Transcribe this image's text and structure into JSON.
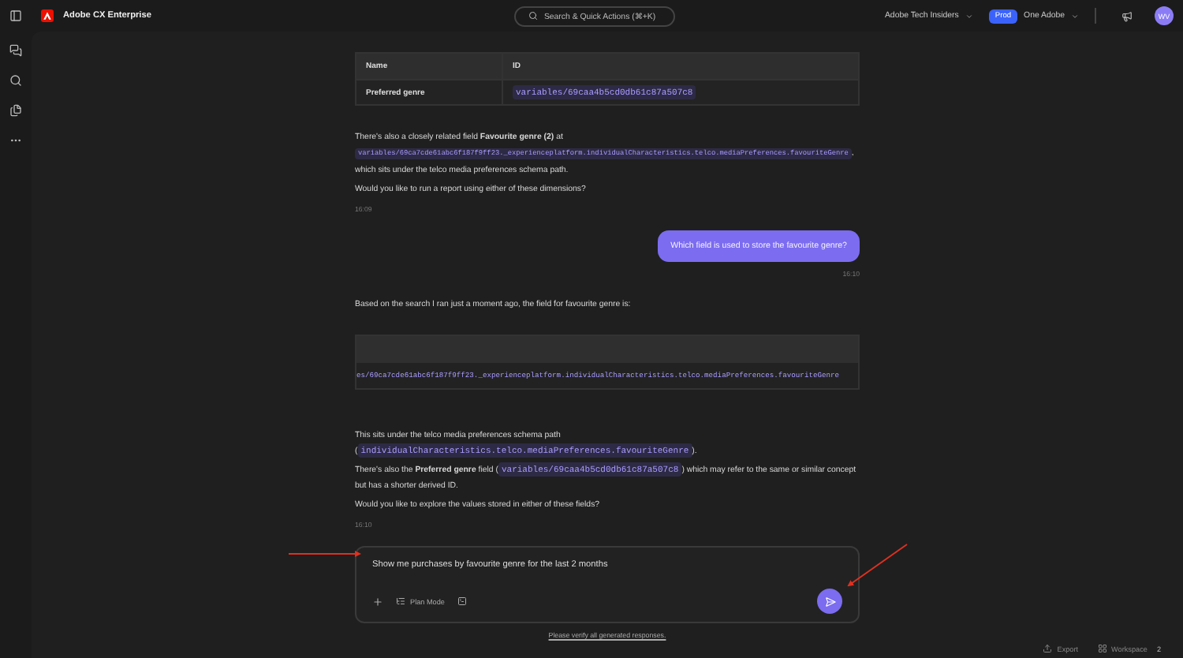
{
  "topbar": {
    "app_name": "Adobe CX Enterprise",
    "search_placeholder": "Search & Quick Actions (⌘+K)",
    "org": "Adobe Tech Insiders",
    "env_badge": "Prod",
    "workspace": "One Adobe",
    "avatar_initials": "WV"
  },
  "messages": [
    {
      "kind": "assistant",
      "blocks": [
        {
          "kind": "table",
          "columns": [
            "Name",
            "ID"
          ],
          "rows": [
            {
              "name": "Preferred genre",
              "id": "variables/69caa4b5cd0db61c87a507c8"
            }
          ]
        },
        {
          "kind": "paragraph",
          "parts": [
            {
              "kind": "text",
              "text": "There's also a closely related field **Favourite genre (2)** at "
            },
            {
              "kind": "code",
              "text": "variables/69ca7cde61abc6f187f9ff23._experienceplatform.individualCharacteristics.telco.mediaPreferences.favouriteGenre"
            },
            {
              "kind": "text",
              "text": ", which sits under the telco media preferences schema path."
            }
          ]
        },
        {
          "kind": "paragraph",
          "parts": [
            {
              "kind": "text",
              "text": "Would you like to run a report using either of these dimensions?"
            }
          ]
        }
      ],
      "time": "16:09"
    },
    {
      "kind": "user",
      "text": "Which field is used to store the favourite genre?",
      "time": "16:10"
    },
    {
      "kind": "assistant",
      "blocks": [
        {
          "kind": "paragraph",
          "parts": [
            {
              "kind": "text",
              "text": "Based on the search I ran just a moment ago, the field for favourite genre is:"
            }
          ]
        },
        {
          "kind": "code_block",
          "code": "es/69ca7cde61abc6f187f9ff23._experienceplatform.individualCharacteristics.telco.mediaPreferences.favouriteGenre"
        },
        {
          "kind": "paragraph",
          "parts": [
            {
              "kind": "text",
              "text": "This sits under the telco media preferences schema path ("
            },
            {
              "kind": "code",
              "text": "individualCharacteristics.telco.mediaPreferences.favouriteGenre"
            },
            {
              "kind": "text",
              "text": ")."
            }
          ]
        },
        {
          "kind": "paragraph",
          "parts": [
            {
              "kind": "text",
              "text": "There's also the **Preferred genre** field ("
            },
            {
              "kind": "code",
              "text": "variables/69caa4b5cd0db61c87a507c8"
            },
            {
              "kind": "text",
              "text": ") which may refer to the same or similar concept but has a shorter derived ID."
            }
          ]
        },
        {
          "kind": "paragraph",
          "parts": [
            {
              "kind": "text",
              "text": "Would you like to explore the values stored in either of these fields?"
            }
          ]
        }
      ],
      "time": "16:10"
    }
  ],
  "composer": {
    "value": "Show me purchases by favourite genre for the last 2 months",
    "plan_mode_label": "Plan Mode"
  },
  "disclaimer": "Please verify all generated responses.",
  "footer": {
    "export_label": "Export",
    "workspace_label": "Workspace",
    "workspace_count": "2"
  }
}
